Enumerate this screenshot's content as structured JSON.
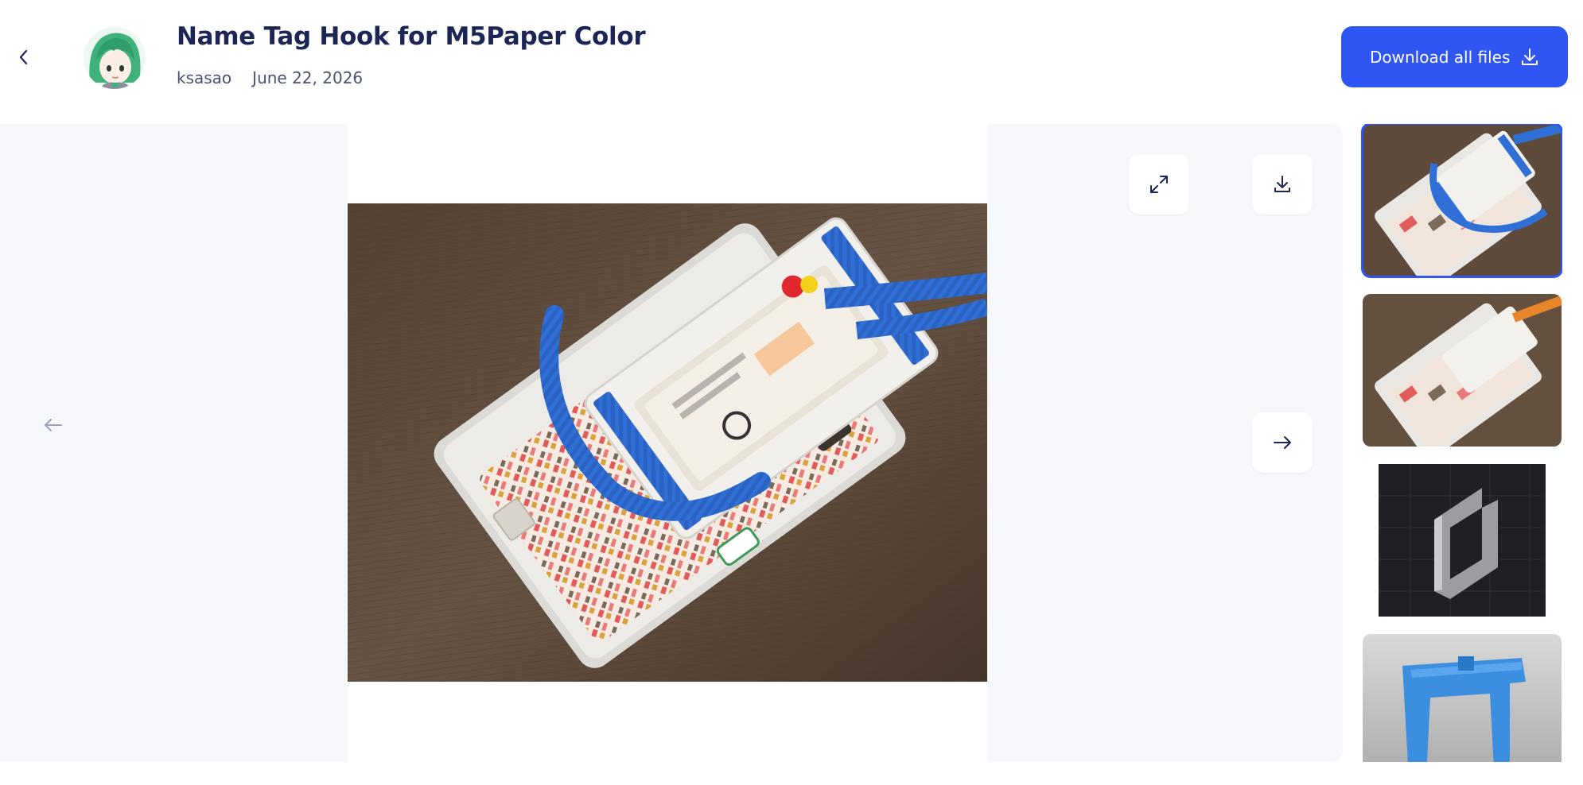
{
  "header": {
    "back_icon": "chevron-left-icon",
    "title": "Name Tag Hook for M5Paper Color",
    "author": "ksasao",
    "date": "June 22, 2026",
    "download_all_label": "Download all files",
    "download_icon": "download-icon"
  },
  "viewer": {
    "expand_icon": "expand-icon",
    "download_icon": "download-icon",
    "prev_icon": "arrow-left-icon",
    "next_icon": "arrow-right-icon",
    "current_index": 0
  },
  "thumbnails": [
    {
      "kind": "photo",
      "selected": true
    },
    {
      "kind": "photo",
      "selected": false
    },
    {
      "kind": "render-dark",
      "selected": false
    },
    {
      "kind": "render-blue",
      "selected": false
    }
  ],
  "colors": {
    "accent": "#2f56f3",
    "title": "#1b2556",
    "viewer_bg": "#f5f7fb",
    "strap_blue": "#2f6fd6"
  }
}
